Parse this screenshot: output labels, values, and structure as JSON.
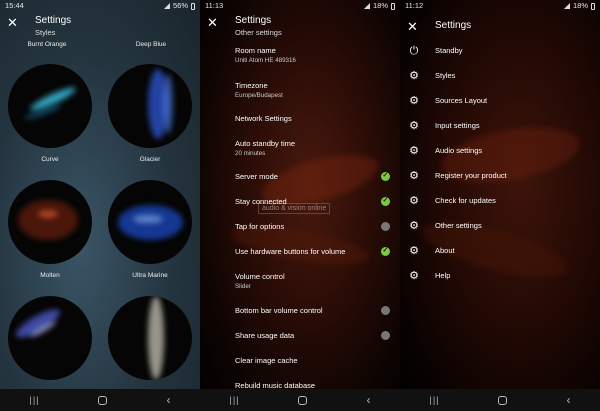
{
  "panel_styles": {
    "status": {
      "time": "15:44",
      "battery": "56%"
    },
    "title": "Settings",
    "subtitle": "Styles",
    "styles": [
      {
        "name": "Burnt Orange"
      },
      {
        "name": "Deep Blue"
      },
      {
        "name": "Curve"
      },
      {
        "name": "Glacier"
      },
      {
        "name": "Molten"
      },
      {
        "name": "Ultra Marine"
      }
    ]
  },
  "panel_other": {
    "status": {
      "time": "11:13",
      "battery": "18%"
    },
    "title": "Settings",
    "subtitle": "Other settings",
    "items": [
      {
        "label": "Room name",
        "value": "Uniti Atom HE 489316"
      },
      {
        "label": "Timezone",
        "value": "Europe/Budapest"
      },
      {
        "label": "Network Settings"
      },
      {
        "label": "Auto standby time",
        "value": "20 minutes"
      },
      {
        "label": "Server mode",
        "toggle": "on"
      },
      {
        "label": "Stay connected",
        "toggle": "on"
      },
      {
        "label": "Tap for options",
        "toggle": "off"
      },
      {
        "label": "Use hardware buttons for volume",
        "toggle": "on"
      },
      {
        "label": "Volume control",
        "value": "Slider"
      },
      {
        "label": "Bottom bar volume control",
        "toggle": "off"
      },
      {
        "label": "Share usage data",
        "toggle": "off"
      },
      {
        "label": "Clear image cache"
      },
      {
        "label": "Rebuild music database"
      }
    ],
    "watermark": "audio & vision online"
  },
  "panel_menu": {
    "status": {
      "time": "11:12",
      "battery": "18%"
    },
    "title": "Settings",
    "items": [
      {
        "label": "Standby",
        "icon": "power-icon"
      },
      {
        "label": "Styles",
        "icon": "gear-icon"
      },
      {
        "label": "Sources Layout",
        "icon": "gear-icon"
      },
      {
        "label": "Input settings",
        "icon": "gear-icon"
      },
      {
        "label": "Audio settings",
        "icon": "gear-icon"
      },
      {
        "label": "Register your product",
        "icon": "gear-icon"
      },
      {
        "label": "Check for updates",
        "icon": "gear-icon"
      },
      {
        "label": "Other settings",
        "icon": "gear-icon"
      },
      {
        "label": "About",
        "icon": "gear-icon"
      },
      {
        "label": "Help",
        "icon": "gear-icon"
      }
    ]
  },
  "colors": {
    "toggle_on": "#7ac943",
    "toggle_off": "#777777"
  }
}
